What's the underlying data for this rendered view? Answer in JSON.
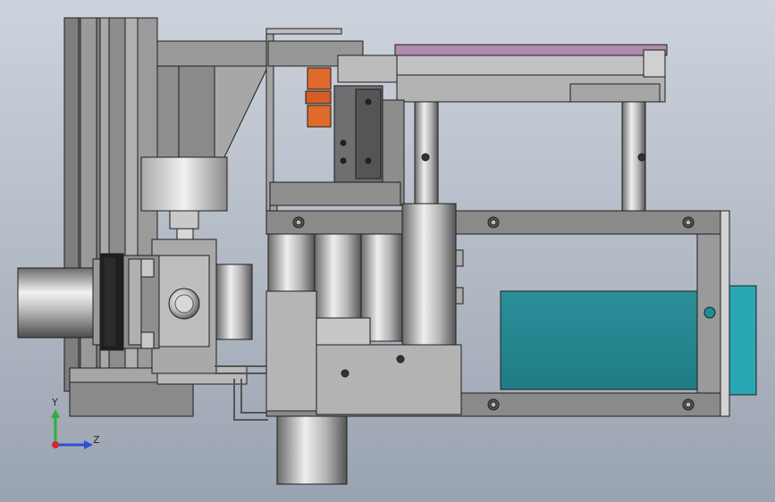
{
  "scene": {
    "description_visible": false,
    "background_top": "#cdd3dc",
    "background_bottom": "#9aa3b1"
  },
  "triad": {
    "y_label": "Y",
    "z_label": "Z",
    "y_color": "#2fae3a",
    "z_color": "#2f4fd8",
    "x_color": "#d02a2a"
  },
  "colors": {
    "frame_gray": "#8e8e8e",
    "frame_light": "#b8b8b8",
    "frame_dark": "#5c5c5c",
    "outline": "#1e1e1e",
    "accent_orange": "#e0692c",
    "accent_purple": "#b08ab0",
    "accent_teal": "#23868f",
    "accent_teal_light": "#2aa7b4",
    "steel_light": "#e6e6e6",
    "steel_mid": "#9a9a9a"
  }
}
